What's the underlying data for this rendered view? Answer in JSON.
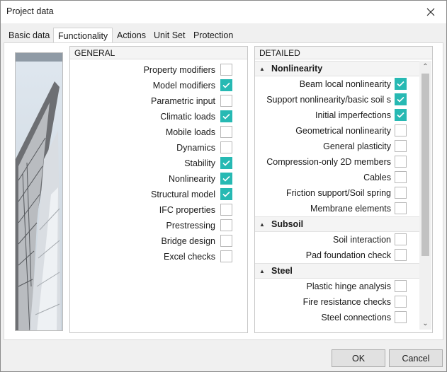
{
  "window": {
    "title": "Project data"
  },
  "tabs": [
    "Basic data",
    "Functionality",
    "Actions",
    "Unit Set",
    "Protection"
  ],
  "active_tab": "Functionality",
  "general": {
    "header": "GENERAL",
    "items": [
      {
        "label": "Property modifiers",
        "checked": false
      },
      {
        "label": "Model modifiers",
        "checked": true,
        "highlighted": true
      },
      {
        "label": "Parametric input",
        "checked": false
      },
      {
        "label": "Climatic loads",
        "checked": true
      },
      {
        "label": "Mobile loads",
        "checked": false
      },
      {
        "label": "Dynamics",
        "checked": false
      },
      {
        "label": "Stability",
        "checked": true
      },
      {
        "label": "Nonlinearity",
        "checked": true
      },
      {
        "label": "Structural model",
        "checked": true
      },
      {
        "label": "IFC properties",
        "checked": false
      },
      {
        "label": "Prestressing",
        "checked": false
      },
      {
        "label": "Bridge design",
        "checked": false
      },
      {
        "label": "Excel checks",
        "checked": false
      }
    ]
  },
  "detailed": {
    "header": "DETAILED",
    "sections": [
      {
        "name": "Nonlinearity",
        "items": [
          {
            "label": "Beam local nonlinearity",
            "checked": true
          },
          {
            "label": "Support nonlinearity/basic soil s",
            "checked": true
          },
          {
            "label": "Initial imperfections",
            "checked": true
          },
          {
            "label": "Geometrical nonlinearity",
            "checked": false
          },
          {
            "label": "General plasticity",
            "checked": false
          },
          {
            "label": "Compression-only 2D members",
            "checked": false
          },
          {
            "label": "Cables",
            "checked": false
          },
          {
            "label": "Friction support/Soil spring",
            "checked": false
          },
          {
            "label": "Membrane elements",
            "checked": false
          }
        ]
      },
      {
        "name": "Subsoil",
        "items": [
          {
            "label": "Soil interaction",
            "checked": false
          },
          {
            "label": "Pad foundation check",
            "checked": false
          }
        ]
      },
      {
        "name": "Steel",
        "items": [
          {
            "label": "Plastic hinge analysis",
            "checked": false
          },
          {
            "label": "Fire resistance checks",
            "checked": false
          },
          {
            "label": "Steel connections",
            "checked": false
          }
        ]
      }
    ]
  },
  "buttons": {
    "ok": "OK",
    "cancel": "Cancel"
  },
  "colors": {
    "check_on": "#27b9b3",
    "highlight": "#e01010"
  },
  "icons": {
    "close": "close-icon",
    "check": "check-icon",
    "collapse": "collapse-arrow-icon"
  }
}
